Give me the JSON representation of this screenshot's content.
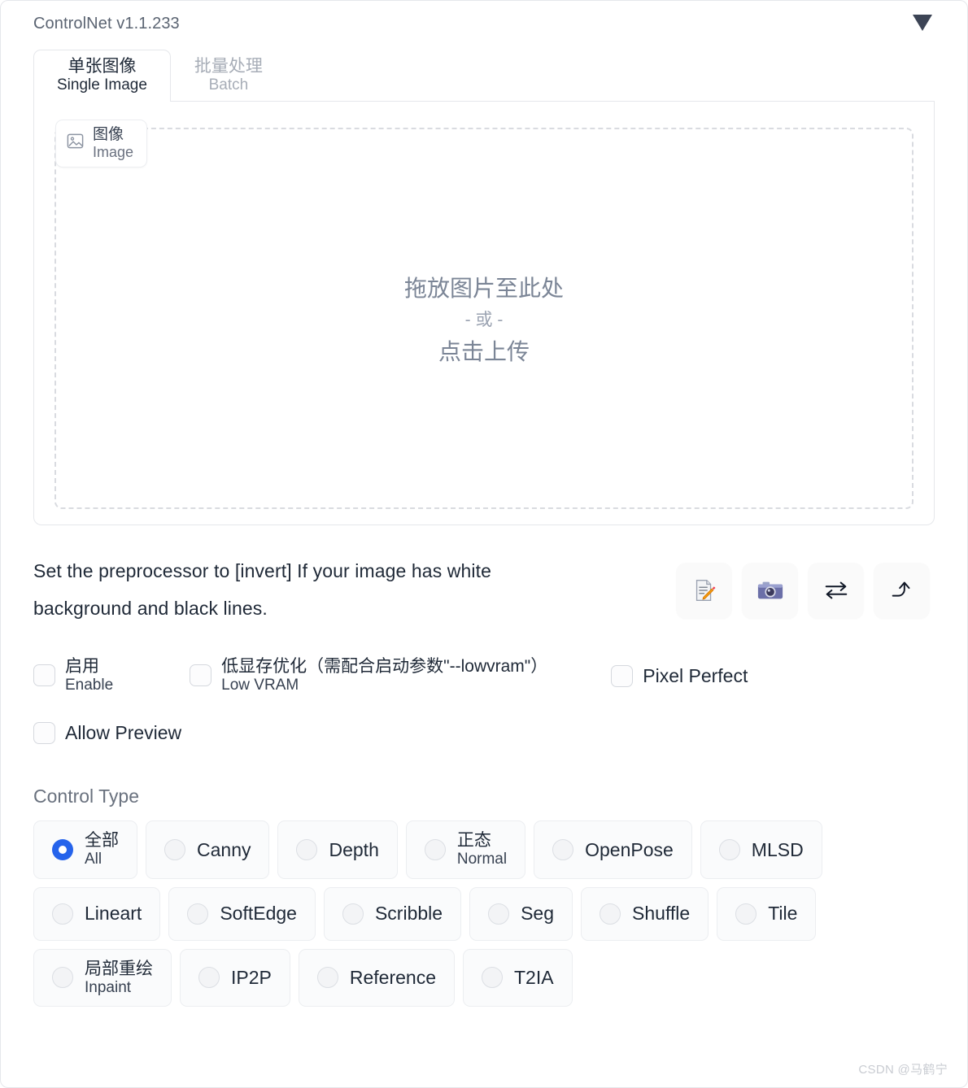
{
  "header": {
    "title": "ControlNet v1.1.233",
    "collapse_icon": "triangle-down-icon",
    "collapse_color": "#3c4455"
  },
  "tabs": [
    {
      "cn": "单张图像",
      "en": "Single Image",
      "active": true
    },
    {
      "cn": "批量处理",
      "en": "Batch",
      "active": false
    }
  ],
  "upload": {
    "badge": {
      "cn": "图像",
      "en": "Image",
      "icon": "picture-icon"
    },
    "drop_line1": "拖放图片至此处",
    "drop_line2": "- 或 -",
    "drop_line3": "点击上传"
  },
  "hint": {
    "text": "Set the preprocessor to [invert] If your image has white background and black lines."
  },
  "icon_buttons": [
    {
      "name": "edit-memo-icon",
      "glyph": "📝"
    },
    {
      "name": "camera-icon",
      "glyph": "📷"
    },
    {
      "name": "swap-arrows-icon",
      "glyph": "⇄"
    },
    {
      "name": "arrow-heading-up-icon",
      "glyph": "⤴"
    }
  ],
  "checkboxes": {
    "enable": {
      "cn": "启用",
      "en": "Enable",
      "checked": false
    },
    "low_vram": {
      "cn": "低显存优化（需配合启动参数\"--lowvram\"）",
      "en": "Low VRAM",
      "checked": false
    },
    "pixel_perfect": {
      "label": "Pixel Perfect",
      "checked": false
    },
    "allow_preview": {
      "label": "Allow Preview",
      "checked": false
    }
  },
  "control_type": {
    "title": "Control Type",
    "selected": "全部 All",
    "accent": "#2563eb",
    "rows": [
      [
        {
          "cn": "全部",
          "en": "All",
          "checked": true
        },
        {
          "single": "Canny",
          "checked": false
        },
        {
          "single": "Depth",
          "checked": false
        },
        {
          "cn": "正态",
          "en": "Normal",
          "checked": false
        },
        {
          "single": "OpenPose",
          "checked": false
        },
        {
          "single": "MLSD",
          "checked": false
        }
      ],
      [
        {
          "single": "Lineart",
          "checked": false
        },
        {
          "single": "SoftEdge",
          "checked": false
        },
        {
          "single": "Scribble",
          "checked": false
        },
        {
          "single": "Seg",
          "checked": false
        },
        {
          "single": "Shuffle",
          "checked": false
        },
        {
          "single": "Tile",
          "checked": false
        }
      ],
      [
        {
          "cn": "局部重绘",
          "en": "Inpaint",
          "checked": false
        },
        {
          "single": "IP2P",
          "checked": false
        },
        {
          "single": "Reference",
          "checked": false
        },
        {
          "single": "T2IA",
          "checked": false
        }
      ]
    ]
  },
  "watermark": "CSDN @马鹤宁"
}
